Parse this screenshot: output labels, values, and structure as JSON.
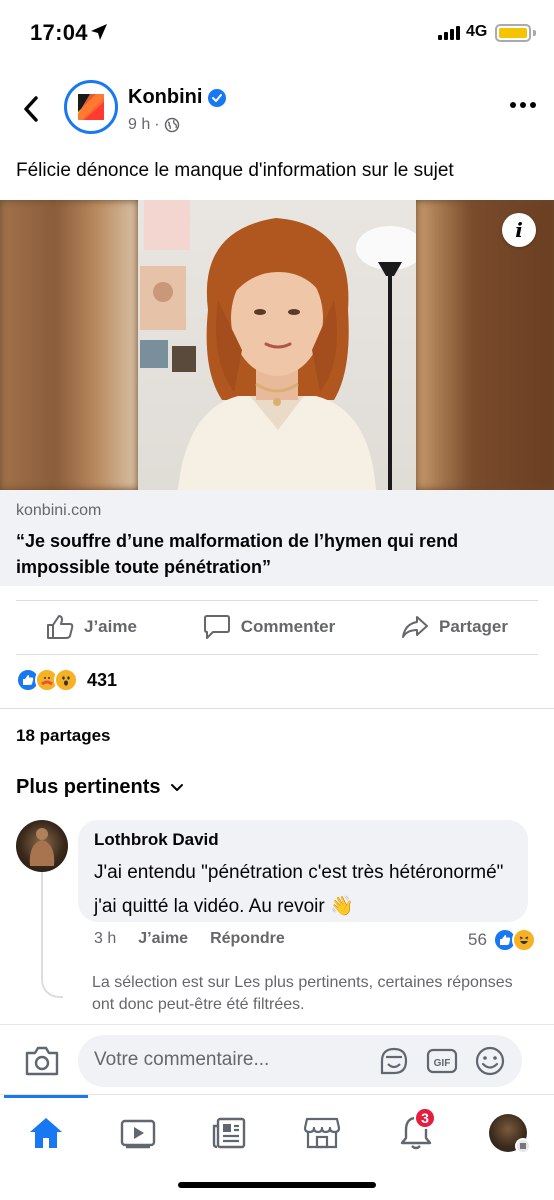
{
  "status_bar": {
    "time": "17:04",
    "network": "4G"
  },
  "post": {
    "page_name": "Konbini",
    "time_ago": "9 h",
    "caption": "Félicie dénonce le manque d'information sur le sujet",
    "link": {
      "domain": "konbini.com",
      "title": "“Je souffre d’une malformation de l’hymen qui rend impossible toute pénétration”"
    }
  },
  "actions": {
    "like": "J’aime",
    "comment": "Commenter",
    "share": "Partager"
  },
  "reactions": {
    "count": "431"
  },
  "shares": "18 partages",
  "sort": {
    "label": "Plus pertinents"
  },
  "comment": {
    "author": "Lothbrok David",
    "text": "J'ai entendu \"pénétration c'est très hétéronormé\" j'ai quitté la vidéo. Au revoir 👋",
    "time": "3 h",
    "like": "J’aime",
    "reply": "Répondre",
    "reaction_count": "56"
  },
  "filter_note": "La sélection est sur Les plus pertinents, certaines réponses ont donc peut-être été filtrées.",
  "composer": {
    "placeholder": "Votre commentaire..."
  },
  "tabbar": {
    "notifications_badge": "3"
  },
  "colors": {
    "accent": "#1877f2",
    "badge": "#e41e3f",
    "battery": "#f5c400"
  }
}
